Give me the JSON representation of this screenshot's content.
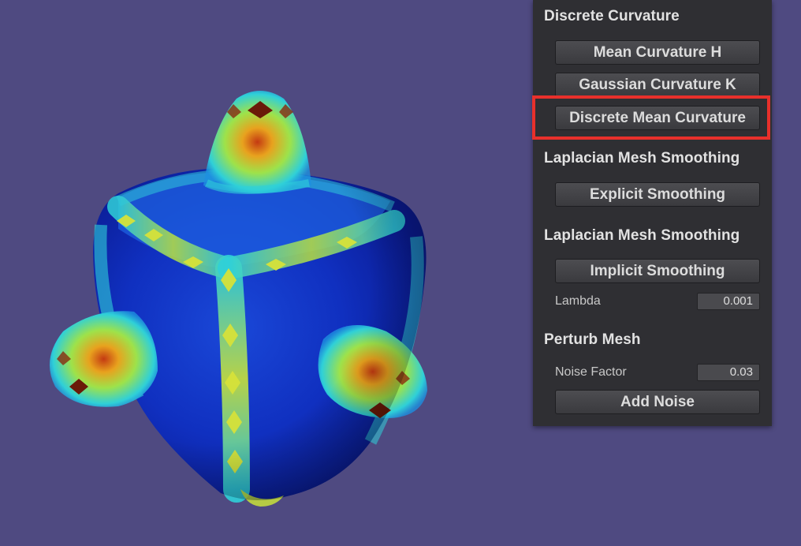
{
  "viewport": {
    "background_color": "#4f4a81",
    "mesh": {
      "description_icon": "mesh-render",
      "colormap": [
        "#0a1fb0",
        "#1d5fe0",
        "#2fd0d8",
        "#c8e23a",
        "#e8a21e",
        "#c43a12",
        "#5a1208"
      ]
    }
  },
  "panel": {
    "sections": [
      {
        "title": "Discrete Curvature",
        "buttons": [
          "Mean Curvature H",
          "Gaussian Curvature K",
          "Discrete Mean Curvature"
        ]
      },
      {
        "title": "Laplacian Mesh Smoothing",
        "buttons": [
          "Explicit Smoothing"
        ]
      },
      {
        "title": "Laplacian Mesh Smoothing",
        "buttons": [
          "Implicit Smoothing"
        ],
        "fields": [
          {
            "label": "Lambda",
            "value": "0.001"
          }
        ]
      },
      {
        "title": "Perturb Mesh",
        "fields": [
          {
            "label": "Noise Factor",
            "value": "0.03"
          }
        ],
        "buttons": [
          "Add Noise"
        ]
      }
    ],
    "highlight_color": "#e8302b",
    "highlighted_button": "Discrete Mean Curvature"
  }
}
